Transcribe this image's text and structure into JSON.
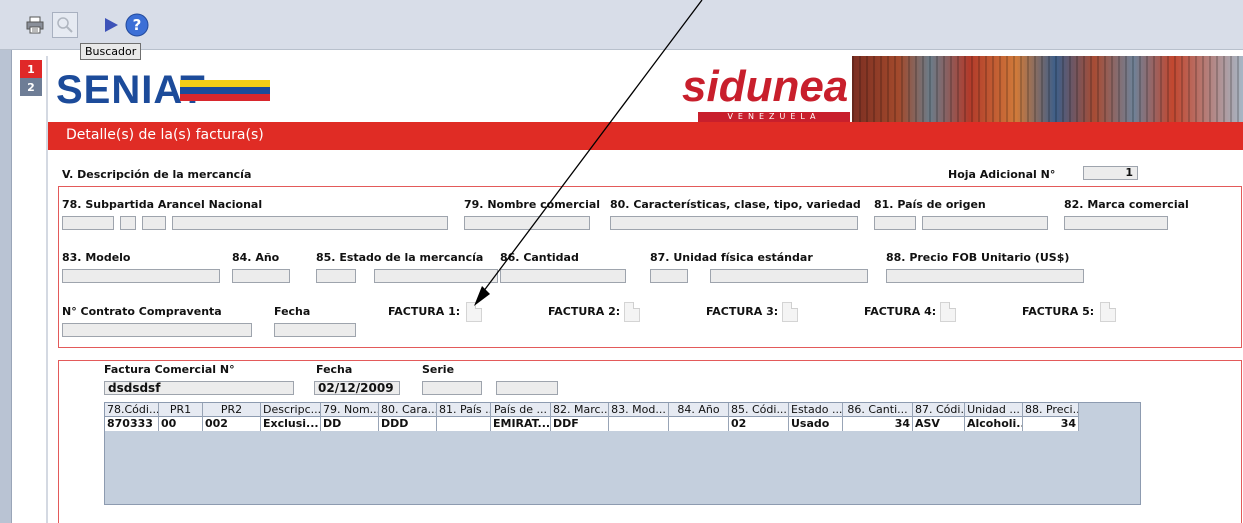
{
  "toolbar": {
    "tooltip": "Buscador",
    "icons": [
      "printer-icon",
      "search-icon",
      "play-icon",
      "help-icon"
    ]
  },
  "pages": [
    "1",
    "2"
  ],
  "banner": {
    "left_logo": "SENIAT",
    "right_logo": "sidunea",
    "right_logo_strip": "VENEZUELA"
  },
  "section": {
    "title": "Detalle(s) de la(s) factura(s)"
  },
  "header": {
    "description_label": "V. Descripción de la mercancía",
    "hoja_label": "Hoja Adicional N°",
    "hoja_value": "1"
  },
  "fields": {
    "f78": "78. Subpartida Arancel Nacional",
    "f79": "79. Nombre comercial",
    "f80": "80. Características, clase, tipo, variedad",
    "f81": "81. País de origen",
    "f82": "82. Marca comercial",
    "f83": "83. Modelo",
    "f84": "84. Año",
    "f85": "85. Estado de la mercancía",
    "f86": "86. Cantidad",
    "f87": "87. Unidad física estándar",
    "f88": "88. Precio FOB Unitario (US$)",
    "contrato": "N° Contrato Compraventa",
    "fecha": "Fecha",
    "factura1": "FACTURA 1:",
    "factura2": "FACTURA 2:",
    "factura3": "FACTURA 3:",
    "factura4": "FACTURA 4:",
    "factura5": "FACTURA 5:"
  },
  "invoice": {
    "numero_label": "Factura Comercial N°",
    "fecha_label": "Fecha",
    "serie_label": "Serie",
    "numero_value": "dsdsdsf",
    "fecha_value": "02/12/2009",
    "serie_value": "",
    "serie_value_2": ""
  },
  "table": {
    "columns": [
      "78.Códi...",
      "PR1",
      "PR2",
      "Descripc...",
      "79. Nom...",
      "80. Cara...",
      "81. País ...",
      "País de ...",
      "82. Marc...",
      "83. Mod...",
      "84. Año",
      "85. Códi...",
      "Estado ...",
      "86. Canti...",
      "87. Códi...",
      "Unidad ...",
      "88. Preci..."
    ],
    "rows": [
      [
        "870333",
        "00",
        "002",
        "Exclusi...",
        "DD",
        "DDD",
        "",
        "EMIRAT...",
        "DDF",
        "",
        "",
        "02",
        "Usado",
        "34",
        "ASV",
        "Alcoholi...",
        "34"
      ]
    ]
  },
  "colors": {
    "accent_red": "#e02c25",
    "panel_border": "#e35a5a",
    "grid_bg": "#c4cfdd"
  }
}
